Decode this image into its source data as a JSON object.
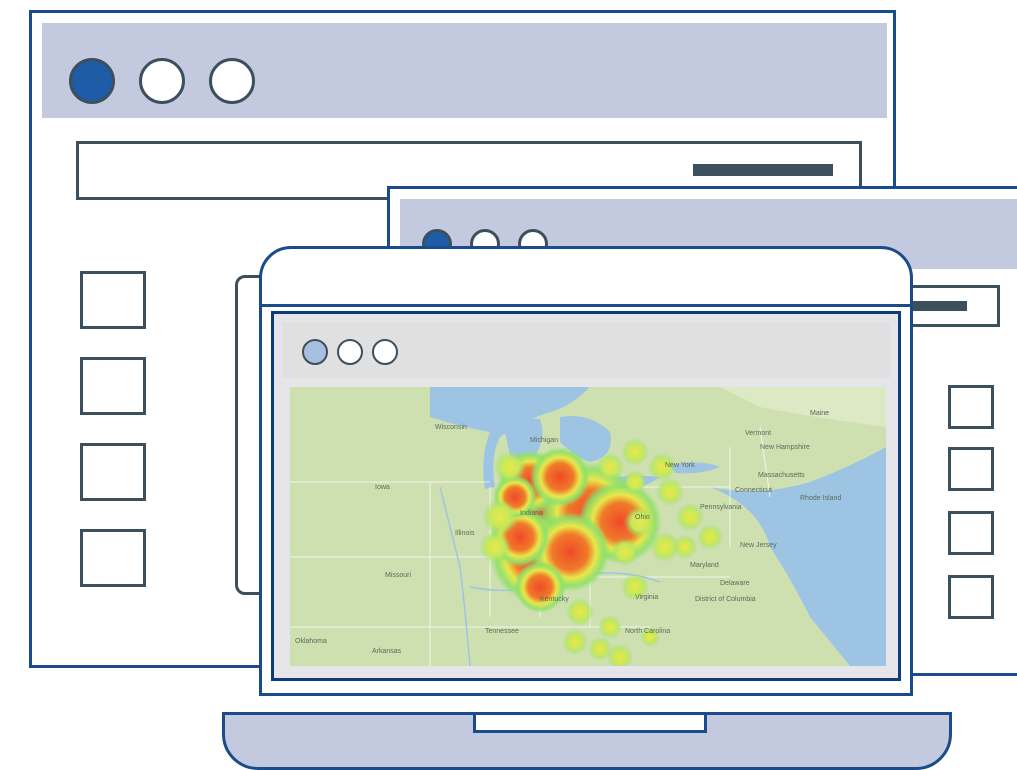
{
  "colors": {
    "frame_blue": "#1a4c8c",
    "titlebar_lavender": "#c3c9de",
    "outline_gray": "#3b4f5c",
    "dot_filled": "#1f5ca8",
    "dot_light": "#a8bfe0",
    "heat_red": "#f04a2a",
    "heat_yellow": "#e8e84a",
    "heat_green": "#8ee06a",
    "land": "#cfe0b0",
    "water": "#9ec4e4"
  },
  "icons": {
    "window_controls": "circle-icon",
    "placeholder_block": "square-icon",
    "map": "heatmap-map-icon"
  },
  "map": {
    "labels": [
      "Wisconsin",
      "Michigan",
      "Iowa",
      "Illinois",
      "Missouri",
      "Oklahoma",
      "Arkansas",
      "Tennessee",
      "Ohio",
      "Virginia",
      "Pennsylvania",
      "New York",
      "Vermont",
      "New Hampshire",
      "Massachusetts",
      "Connecticut",
      "Rhode Island",
      "Maine",
      "New Jersey",
      "Maryland",
      "Delaware",
      "District of Columbia",
      "North Carolina",
      "Kentucky",
      "Indiana"
    ]
  }
}
